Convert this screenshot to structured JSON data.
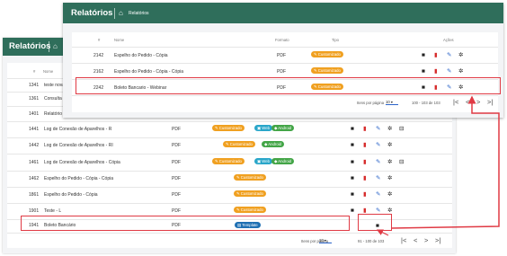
{
  "back": {
    "title": "Relatórios",
    "home_icon": "home-icon",
    "crumb": "",
    "columns": {
      "id": "#",
      "name": "Nome"
    },
    "rows": [
      {
        "id": "1341",
        "name": "teste nova",
        "truncated": true
      },
      {
        "id": "1361",
        "name": "Consulta b",
        "truncated": true
      },
      {
        "id": "1401",
        "name": "Relatório D",
        "truncated": true
      },
      {
        "id": "1441",
        "name": "Log de Conexão de Aparelhos - R",
        "format": "PDF",
        "badges": [
          "Customizado",
          "Web",
          "Android"
        ]
      },
      {
        "id": "1442",
        "name": "Log de Conexão de Aparelhos - RI",
        "format": "PDF",
        "badges": [
          "Customizado",
          "Android"
        ]
      },
      {
        "id": "1461",
        "name": "Log de Conexão de Aparelhos - Cópia",
        "format": "PDF",
        "badges": [
          "Customizado",
          "Web",
          "Android"
        ]
      },
      {
        "id": "1462",
        "name": "Espelho do Pedido - Cópia - Cópia",
        "format": "PDF",
        "badges": [
          "Customizado"
        ]
      },
      {
        "id": "1861",
        "name": "Espelho do Pedido - Cópia",
        "format": "PDF",
        "badges": [
          "Customizado"
        ]
      },
      {
        "id": "1901",
        "name": "Teste - L",
        "format": "PDF",
        "badges": [
          "Customizado"
        ]
      },
      {
        "id": "1941",
        "name": "Boleto Bancário",
        "format": "PDF",
        "badges": [
          "Template"
        ]
      }
    ],
    "pagination": {
      "per_page_label": "Itens por página",
      "per_page": "10",
      "range": "91 - 100 de 103"
    }
  },
  "front": {
    "title": "Relatórios",
    "home_icon": "home-icon",
    "crumb": "Relatórios",
    "columns": {
      "id": "#",
      "name": "Nome",
      "format": "Formato",
      "type": "Tipo",
      "actions": "Ações"
    },
    "rows": [
      {
        "id": "2142",
        "name": "Espelho do Pedido - Cópia",
        "format": "PDF",
        "badge": "Customizado"
      },
      {
        "id": "2162",
        "name": "Espelho do Pedido - Cópia - Cópia",
        "format": "PDF",
        "badge": "Customizado"
      },
      {
        "id": "2242",
        "name": "Boleto Bancario - Webinar",
        "format": "PDF",
        "badge": "Customizado"
      }
    ],
    "pagination": {
      "per_page_label": "Itens por página",
      "per_page": "10",
      "range": "100 - 103 de 103"
    }
  },
  "nav_glyphs": {
    "first": "|<",
    "prev": "<",
    "next": ">",
    "last": ">|"
  },
  "icons": {
    "copy": "copy-icon",
    "delete": "trash-icon",
    "edit": "pencil-icon",
    "settings": "gear-icon",
    "print": "printer-icon"
  },
  "colors": {
    "header": "#2f6e5b",
    "highlight": "#e03a44",
    "customizado": "#f0a020",
    "web": "#29a6c9",
    "android": "#43a547",
    "template": "#1e6fb3"
  }
}
